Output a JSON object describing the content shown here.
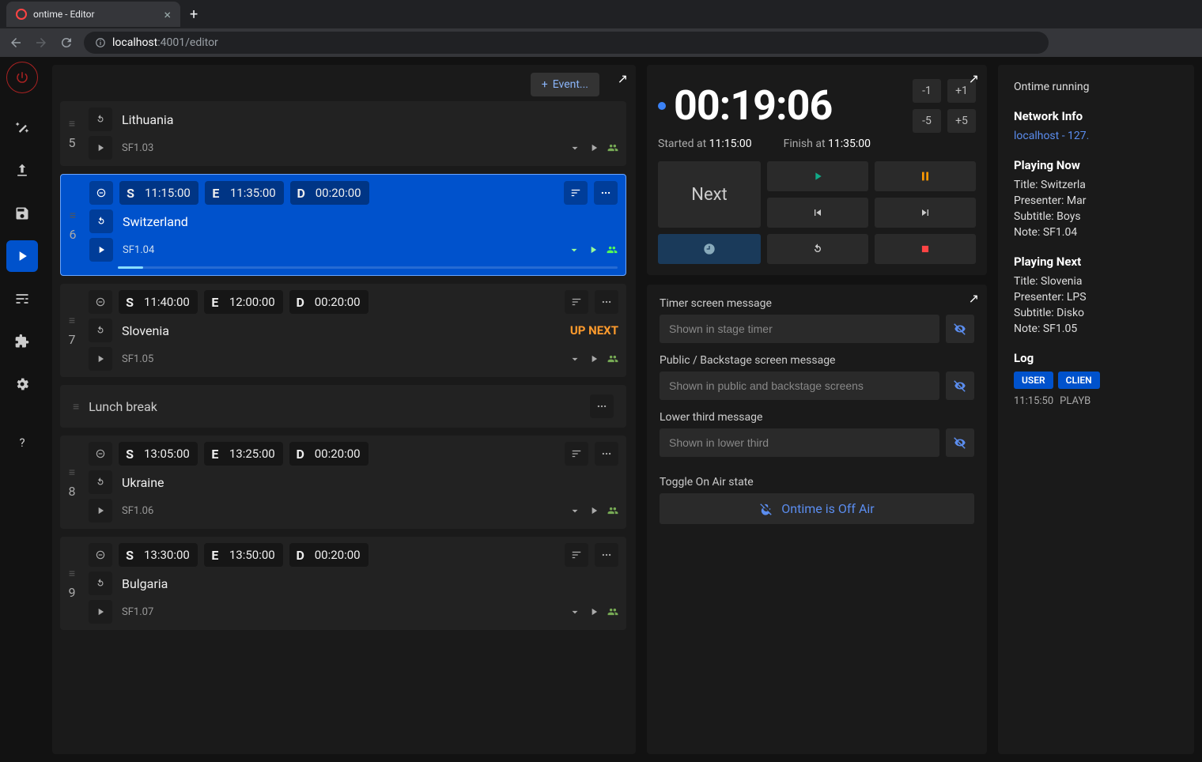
{
  "browser": {
    "tab_title": "ontime - Editor",
    "url_host": "localhost",
    "url_port": ":4001",
    "url_path": "/editor"
  },
  "toolbar": {
    "add_event": "Event..."
  },
  "events": [
    {
      "idx": "5",
      "title": "Lithuania",
      "note": "SF1.03"
    },
    {
      "idx": "6",
      "s": "11:15:00",
      "e": "11:35:00",
      "d": "00:20:00",
      "title": "Switzerland",
      "note": "SF1.04",
      "playing": true,
      "progress": 5
    },
    {
      "idx": "7",
      "s": "11:40:00",
      "e": "12:00:00",
      "d": "00:20:00",
      "title": "Slovenia",
      "note": "SF1.05",
      "upnext": "UP NEXT"
    },
    {
      "break": true,
      "title": "Lunch break"
    },
    {
      "idx": "8",
      "s": "13:05:00",
      "e": "13:25:00",
      "d": "00:20:00",
      "title": "Ukraine",
      "note": "SF1.06"
    },
    {
      "idx": "9",
      "s": "13:30:00",
      "e": "13:50:00",
      "d": "00:20:00",
      "title": "Bulgaria",
      "note": "SF1.07"
    }
  ],
  "timer": {
    "big": "00:19:06",
    "started_label": "Started at",
    "started": "11:15:00",
    "finish_label": "Finish at",
    "finish": "11:35:00",
    "adj": {
      "m1": "-1",
      "p1": "+1",
      "m5": "-5",
      "p5": "+5"
    },
    "next": "Next"
  },
  "messages": {
    "timer_label": "Timer screen message",
    "timer_ph": "Shown in stage timer",
    "public_label": "Public / Backstage screen message",
    "public_ph": "Shown in public and backstage screens",
    "lower_label": "Lower third message",
    "lower_ph": "Shown in lower third",
    "onair_label": "Toggle On Air state",
    "onair_btn": "Ontime is Off Air"
  },
  "info": {
    "running": "Ontime running",
    "network_h": "Network Info",
    "network_link": "localhost - 127.",
    "now_h": "Playing Now",
    "now_title": "Title: Switzerla",
    "now_presenter": "Presenter: Mar",
    "now_subtitle": "Subtitle: Boys ",
    "now_note": "Note: SF1.04",
    "next_h": "Playing Next",
    "next_title": "Title: Slovenia",
    "next_presenter": "Presenter: LPS",
    "next_subtitle": "Subtitle: Disko",
    "next_note": "Note: SF1.05",
    "log_h": "Log",
    "log_user": "USER",
    "log_client": "CLIEN",
    "log_time": "11:15:50",
    "log_msg": "PLAYB"
  }
}
